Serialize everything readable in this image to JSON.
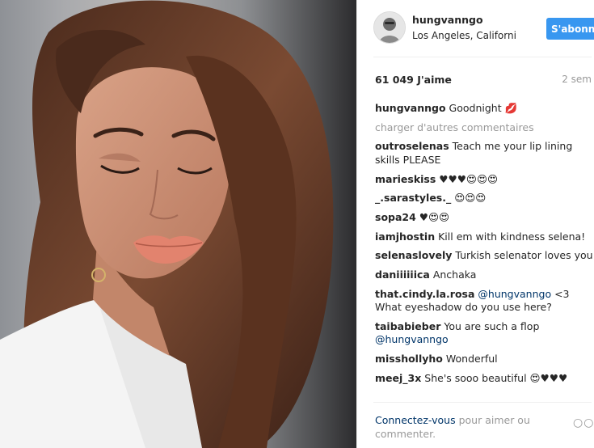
{
  "photo": {
    "description_icon": "portrait-photo"
  },
  "header": {
    "username": "hungvanngo",
    "location": "Los Angeles, California",
    "follow_label": "S'abonner"
  },
  "post": {
    "likes": "61 049 J'aime",
    "time": "2 sem"
  },
  "caption": {
    "user": "hungvanngo",
    "text": "Goodnight 💋"
  },
  "load_more": "charger d'autres commentaires",
  "comments": [
    {
      "user": "outroselenas",
      "text": "Teach me your lip lining skills PLEASE"
    },
    {
      "user": "marieskiss",
      "text": "♥♥♥😍😍😍"
    },
    {
      "user": "_.sarastyles._",
      "text": "😍😍😍"
    },
    {
      "user": "sopa24",
      "text": "♥😍😍"
    },
    {
      "user": "iamjhostin",
      "text": "Kill em with kindness selena!"
    },
    {
      "user": "selenaslovely",
      "text": "Turkish selenator loves you"
    },
    {
      "user": "daniiiiiica",
      "text": "Anchaka"
    },
    {
      "user": "that.cindy.la.rosa",
      "mention": "@hungvanngo",
      "text": "<3 What eyeshadow do you use here?"
    },
    {
      "user": "taibabieber",
      "text": "You are such a flop",
      "mention_after": "@hungvanngo"
    },
    {
      "user": "misshollyho",
      "text": "Wonderful"
    },
    {
      "user": "meej_3x",
      "text": "She's sooo beautiful 😍♥♥♥"
    }
  ],
  "footer": {
    "login_link": "Connectez-vous",
    "login_text": "pour aimer ou commenter.",
    "more_icon": "ellipsis-icon"
  },
  "colors": {
    "accent": "#3897f0",
    "link": "#003569",
    "muted": "#999999"
  }
}
